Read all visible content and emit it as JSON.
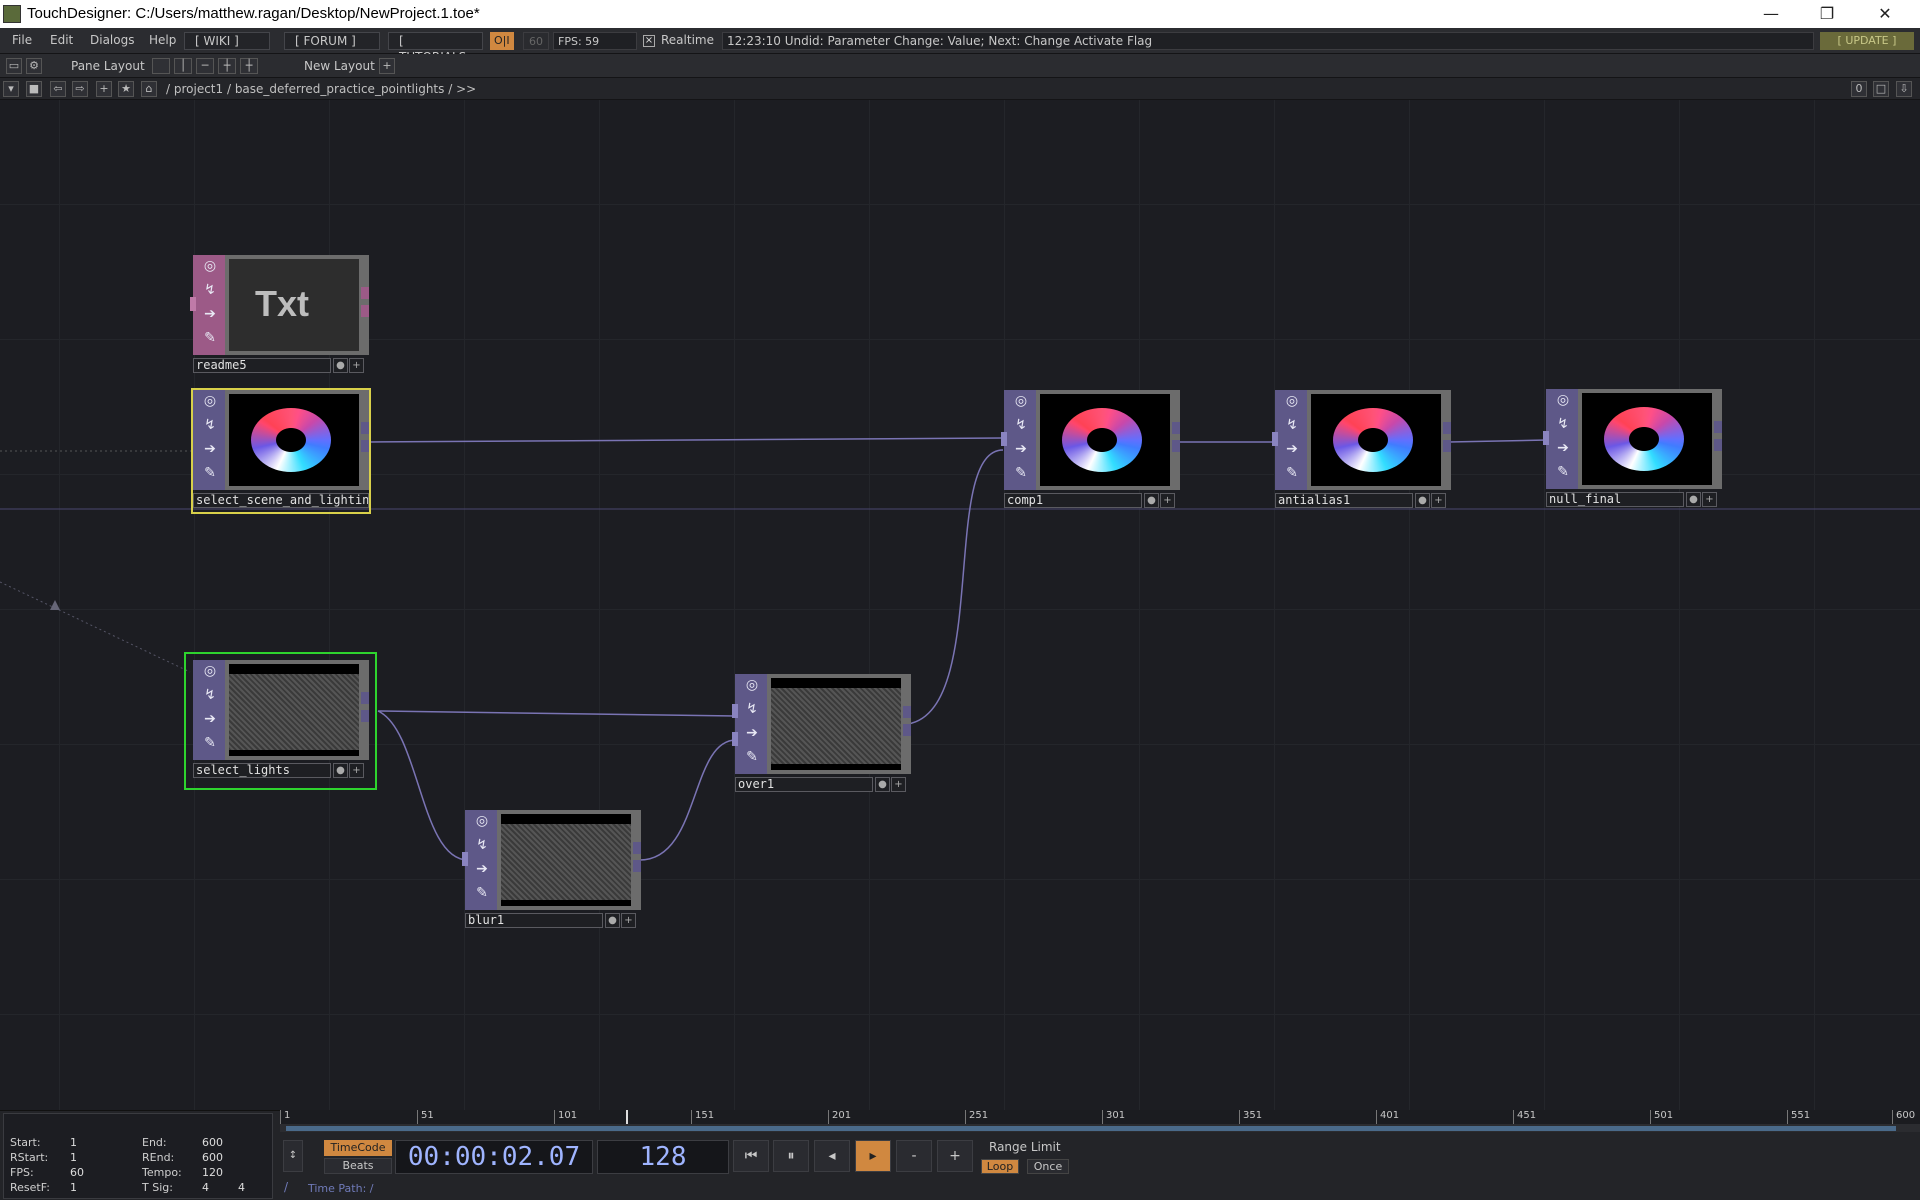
{
  "window": {
    "title": "TouchDesigner: C:/Users/matthew.ragan/Desktop/NewProject.1.toe*",
    "minimize": "—",
    "restore": "❐",
    "close": "✕"
  },
  "menubar": {
    "items": [
      "File",
      "Edit",
      "Dialogs",
      "Help"
    ],
    "wiki": "[ WIKI ]",
    "forum": "[ FORUM ]",
    "tutorials": "[ TUTORIALS ]",
    "oi": "O|I",
    "fps_cap": "60",
    "fps": "FPS:  59",
    "realtime": "Realtime",
    "status": "12:23:10 Undid: Parameter Change: Value; Next: Change Activate Flag",
    "update": "[ UPDATE ]"
  },
  "toolbar": {
    "pane_layout": "Pane Layout",
    "new_layout": "New Layout",
    "add": "+"
  },
  "pathbar": {
    "path": "/ project1 / base_deferred_practice_pointlights / >>",
    "right_count": "0"
  },
  "nodes": {
    "readme": {
      "name": "readme5",
      "logo": "Txt"
    },
    "select_scene": {
      "name": "select_scene_and_lighting"
    },
    "select_lights": {
      "name": "select_lights"
    },
    "blur": {
      "name": "blur1"
    },
    "over": {
      "name": "over1"
    },
    "comp": {
      "name": "comp1"
    },
    "antialias": {
      "name": "antialias1"
    },
    "null_final": {
      "name": "null_final"
    }
  },
  "info": {
    "start_k": "Start:",
    "start_v": "1",
    "end_k": "End:",
    "end_v": "600",
    "rstart_k": "RStart:",
    "rstart_v": "1",
    "rend_k": "REnd:",
    "rend_v": "600",
    "fps_k": "FPS:",
    "fps_v": "60",
    "tempo_k": "Tempo:",
    "tempo_v": "120",
    "resetf_k": "ResetF:",
    "resetf_v": "1",
    "tsig_k": "T Sig:",
    "tsig_v1": "4",
    "tsig_v2": "4"
  },
  "timeline": {
    "ticks": [
      "1",
      "51",
      "101",
      "151",
      "201",
      "251",
      "301",
      "351",
      "401",
      "451",
      "501",
      "551",
      "600"
    ],
    "timecode_btn": "TimeCode",
    "beats_btn": "Beats",
    "timecode": "00:00:02.07",
    "frame": "128",
    "minus": "-",
    "plus": "+",
    "range_limit": "Range Limit",
    "loop": "Loop",
    "once": "Once",
    "time_path": "Time Path: /",
    "slash": "/"
  },
  "colors": {
    "top_purple": "#5e5888",
    "dat_pink": "#9c5a87",
    "selected_yellow": "#d8d04a",
    "selected_green": "#2ed32e",
    "accent_orange": "#d08840",
    "wire": "#7a74b4"
  }
}
